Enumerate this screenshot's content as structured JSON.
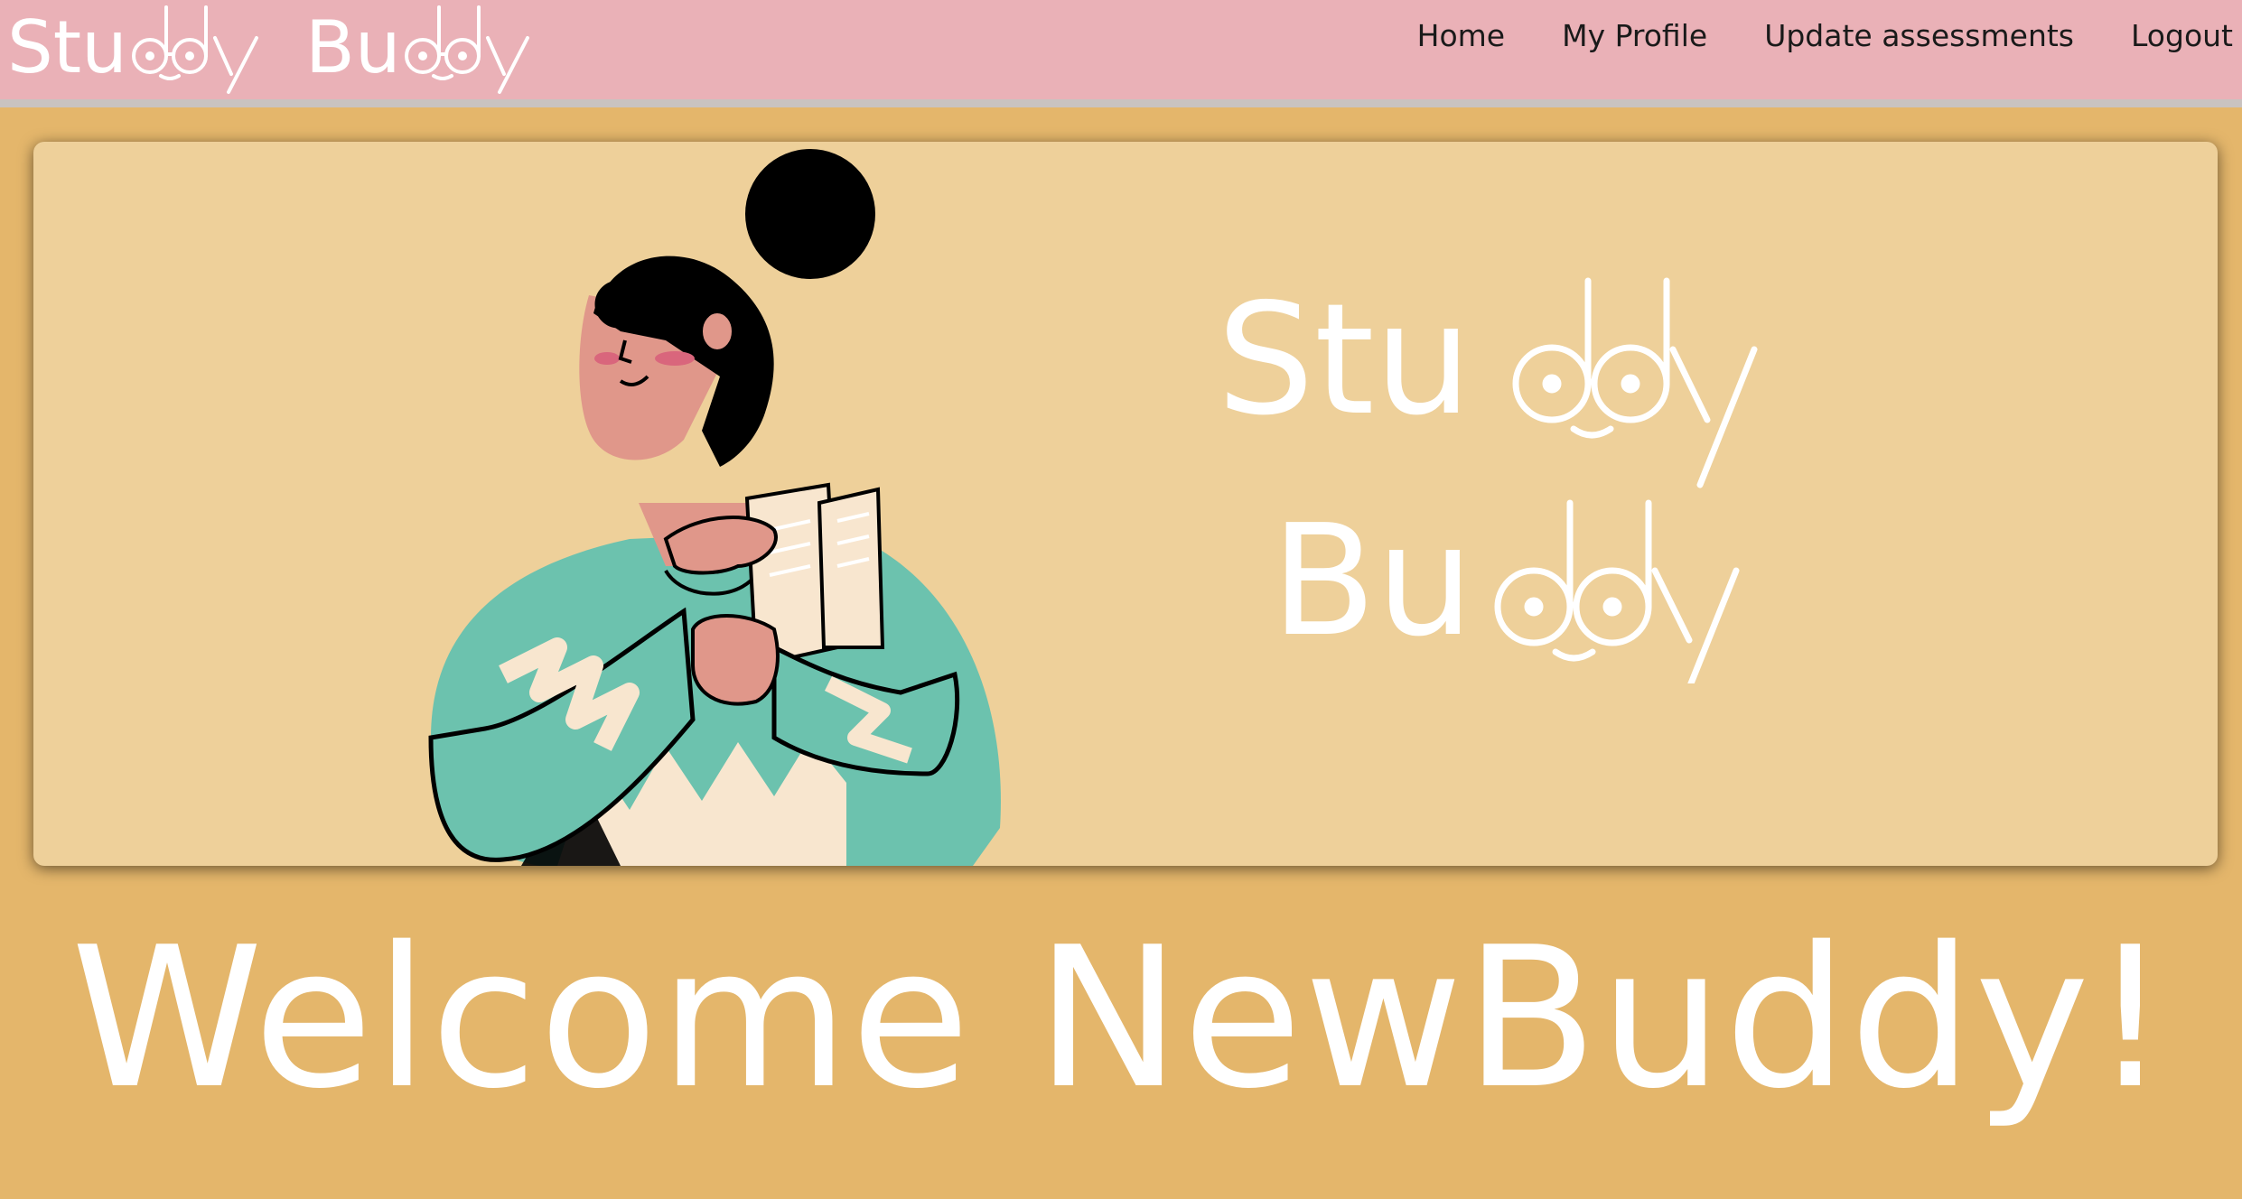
{
  "app": {
    "logo_text_line1": "Studdy",
    "logo_text_line2": "Buddy",
    "logo_text_full": "Studdy Buddy"
  },
  "nav": {
    "items": [
      {
        "label": "Home"
      },
      {
        "label": "My Profile"
      },
      {
        "label": "Update assessments"
      },
      {
        "label": "Logout"
      }
    ]
  },
  "banner": {
    "logo_line1": "Studdy",
    "logo_line2": "Buddy"
  },
  "welcome": {
    "text": "Welcome NewBuddy!"
  },
  "colors": {
    "page_bg": "#e4b66b",
    "navbar_bg": "#eab1b7",
    "banner_bg": "#eed09a",
    "sweater": "#6cc2ae",
    "skin": "#e0978a",
    "hair": "#000000",
    "logo_white": "#ffffff"
  },
  "icons": {
    "logo": "studdy-buddy-glasses-logo",
    "illustration": "woman-holding-papers-illustration"
  }
}
